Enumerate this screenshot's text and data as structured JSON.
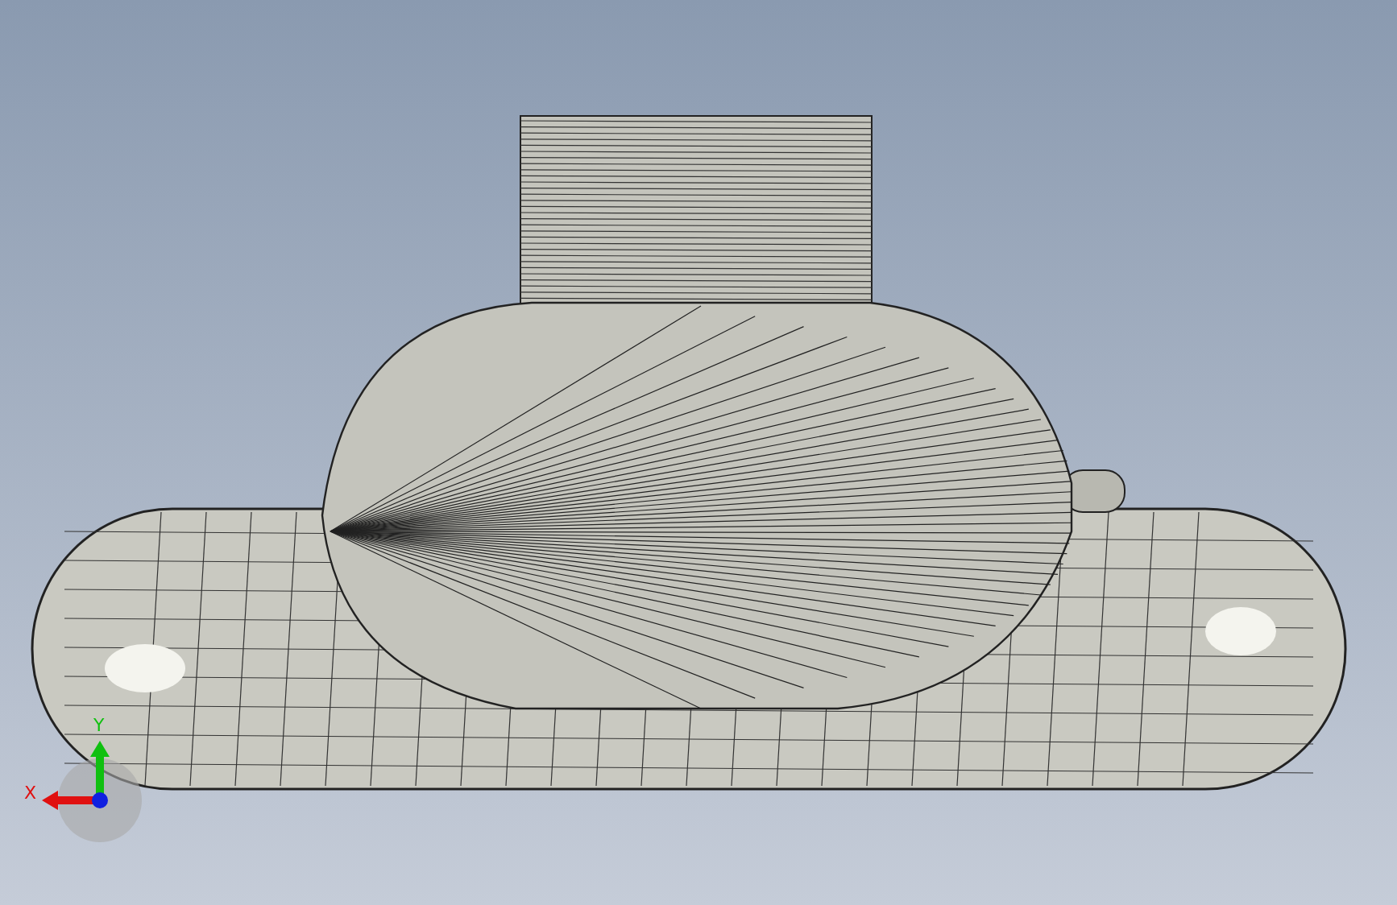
{
  "viewport": {
    "triad": {
      "axes": [
        {
          "label": "X",
          "color": "#e01010"
        },
        {
          "label": "Y",
          "color": "#10c010"
        }
      ]
    }
  }
}
